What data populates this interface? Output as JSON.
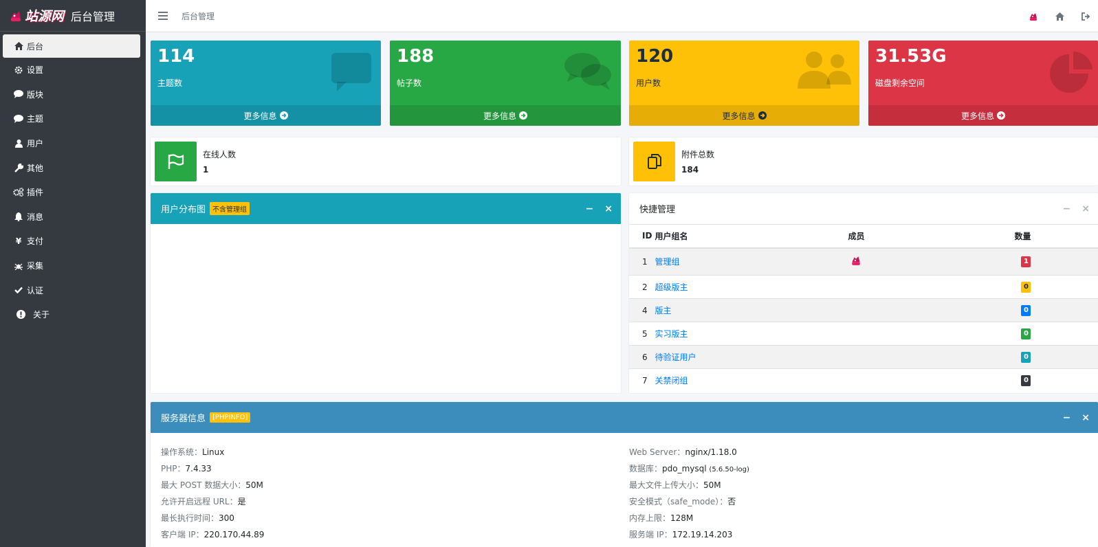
{
  "brand": {
    "logo_text": "站源网",
    "title": "后台管理"
  },
  "sidebar": {
    "items": [
      {
        "label": "后台",
        "icon": "home-icon",
        "active": true
      },
      {
        "label": "设置",
        "icon": "gear-icon"
      },
      {
        "label": "版块",
        "icon": "comment-icon"
      },
      {
        "label": "主题",
        "icon": "comment-icon"
      },
      {
        "label": "用户",
        "icon": "user-icon"
      },
      {
        "label": "其他",
        "icon": "wrench-icon"
      },
      {
        "label": "插件",
        "icon": "cogs-icon"
      },
      {
        "label": "消息",
        "icon": "bell-icon"
      },
      {
        "label": "支付",
        "icon": "yen-icon"
      },
      {
        "label": "采集",
        "icon": "spider-icon"
      },
      {
        "label": "认证",
        "icon": "check-icon"
      },
      {
        "label": "关于",
        "icon": "info-circle-icon"
      }
    ]
  },
  "topbar": {
    "title": "后台管理"
  },
  "stats": [
    {
      "value": "114",
      "label": "主题数",
      "more": "更多信息",
      "color": "#17a2b8",
      "icon": "comment-icon"
    },
    {
      "value": "188",
      "label": "帖子数",
      "more": "更多信息",
      "color": "#28a745",
      "icon": "comments-icon"
    },
    {
      "value": "120",
      "label": "用户数",
      "more": "更多信息",
      "color": "#ffc107",
      "icon": "users-icon"
    },
    {
      "value": "31.53G",
      "label": "磁盘剩余空间",
      "more": "更多信息",
      "color": "#dc3545",
      "icon": "pie-chart-icon"
    }
  ],
  "infoboxes": [
    {
      "label": "在线人数",
      "value": "1",
      "color": "#28a745",
      "icon": "flag-icon"
    },
    {
      "label": "附件总数",
      "value": "184",
      "color": "#ffc107",
      "icon": "copy-icon"
    }
  ],
  "user_chart_card": {
    "title": "用户分布图",
    "badge": "不含管理组",
    "minimize": "−",
    "close": "×"
  },
  "quick_card": {
    "title": "快捷管理",
    "minimize": "−",
    "close": "×",
    "columns": [
      "ID",
      "用户组名",
      "成员",
      "数量"
    ],
    "rows": [
      {
        "id": "1",
        "name": "管理组",
        "member_avatar": true,
        "count": "1",
        "badge_color": "#dc3545"
      },
      {
        "id": "2",
        "name": "超级版主",
        "member_avatar": false,
        "count": "0",
        "badge_color": "#ffc107"
      },
      {
        "id": "4",
        "name": "版主",
        "member_avatar": false,
        "count": "0",
        "badge_color": "#007bff"
      },
      {
        "id": "5",
        "name": "实习版主",
        "member_avatar": false,
        "count": "0",
        "badge_color": "#28a745"
      },
      {
        "id": "6",
        "name": "待验证用户",
        "member_avatar": false,
        "count": "0",
        "badge_color": "#17a2b8"
      },
      {
        "id": "7",
        "name": "关禁闭组",
        "member_avatar": false,
        "count": "0",
        "badge_color": "#343a40"
      }
    ]
  },
  "server_card": {
    "title": "服务器信息",
    "badge": "[PHPINFO]",
    "minimize": "−",
    "close": "×",
    "left": [
      {
        "label": "操作系统：",
        "value": "Linux"
      },
      {
        "label": "PHP：",
        "value": "7.4.33"
      },
      {
        "label": "最大 POST 数据大小：",
        "value": "50M"
      },
      {
        "label": "允许开启远程 URL：",
        "value": "是"
      },
      {
        "label": "最长执行时间：",
        "value": "300"
      },
      {
        "label": "客户端 IP：",
        "value": "220.170.44.89"
      }
    ],
    "right": [
      {
        "label": "Web Server：",
        "value": "nginx/1.18.0"
      },
      {
        "label": "数据库：",
        "value": "pdo_mysql",
        "small": "(5.6.50-log)"
      },
      {
        "label": "最大文件上传大小：",
        "value": "50M"
      },
      {
        "label": "安全模式（safe_mode）：",
        "value": "否"
      },
      {
        "label": "内存上限：",
        "value": "128M"
      },
      {
        "label": "服务端 IP：",
        "value": "172.19.14.203"
      }
    ]
  },
  "colors": {
    "sidebar_bg": "#343a40",
    "info": "#17a2b8",
    "server_header": "#3c8dbc"
  }
}
